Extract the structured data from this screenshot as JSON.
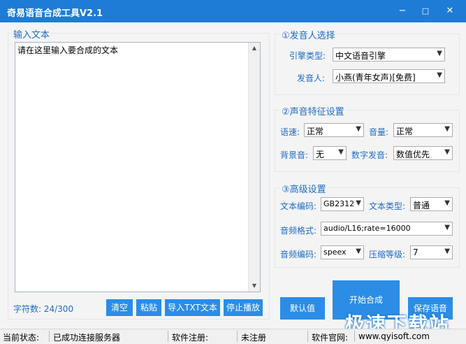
{
  "window": {
    "title": "奇易语音合成工具V2.1",
    "minimize_icon": "−",
    "maximize_icon": "□",
    "close_icon": "✕"
  },
  "input": {
    "legend": "输入文本",
    "placeholder_text": "请在这里输入要合成的文本",
    "char_count": "字符数: 24/300",
    "buttons": {
      "clear": "清空",
      "paste": "粘贴",
      "import": "导入TXT文本",
      "stop": "停止播放"
    }
  },
  "speaker": {
    "legend": "①发音人选择",
    "engine_label": "引擎类型:",
    "engine_value": "中文语音引擎",
    "voice_label": "发音人:",
    "voice_value": "小燕(青年女声)[免费]"
  },
  "voice_features": {
    "legend": "②声音特征设置",
    "speed_label": "语速:",
    "speed_value": "正常",
    "volume_label": "音量:",
    "volume_value": "正常",
    "bgm_label": "背景音:",
    "bgm_value": "无",
    "digit_label": "数字发音:",
    "digit_value": "数值优先"
  },
  "advanced": {
    "legend": "③高级设置",
    "encoding_label": "文本编码:",
    "encoding_value": "GB2312",
    "text_type_label": "文本类型:",
    "text_type_value": "普通",
    "audio_format_label": "音频格式:",
    "audio_format_value": "audio/L16;rate=16000",
    "audio_codec_label": "音频编码:",
    "audio_codec_value": "speex",
    "compress_label": "压缩等级:",
    "compress_value": "7"
  },
  "actions": {
    "default": "默认值",
    "start": "开始合成",
    "save": "保存语音"
  },
  "status": {
    "state_label": "当前状态:",
    "state_value": "已成功连接服务器",
    "reg_label": "软件注册:",
    "reg_value": "未注册",
    "site_label": "软件官网:",
    "site_value": "www.qyisoft.com"
  },
  "watermark": "极速下载站",
  "colors": {
    "titlebar": "#1e7bd6",
    "button": "#2b8de6",
    "label": "#1e6cc8"
  }
}
